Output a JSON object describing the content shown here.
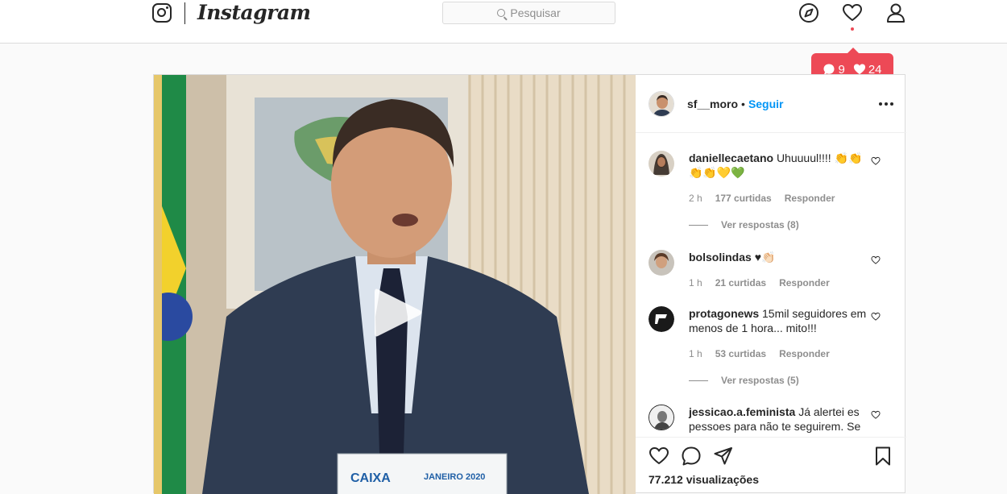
{
  "header": {
    "logo_text": "Instagram",
    "search_placeholder": "Pesquisar"
  },
  "activity": {
    "comments_count": "9",
    "likes_count": "24"
  },
  "post": {
    "username": "sf__moro",
    "separator": "•",
    "follow_label": "Seguir",
    "views_text": "77.212 visualizações",
    "calendar_brand": "CAIXA",
    "calendar_month": "JANEIRO 2020"
  },
  "comments": [
    {
      "user": "daniellecaetano",
      "text": "Uhuuuul!!!! 👏👏👏👏💛💚",
      "time": "2 h",
      "likes": "177 curtidas",
      "reply": "Responder",
      "replies": "Ver respostas (8)"
    },
    {
      "user": "bolsolindas",
      "text": "♥👏🏻",
      "time": "1 h",
      "likes": "21 curtidas",
      "reply": "Responder"
    },
    {
      "user": "protagonews",
      "text": "15mil seguidores em menos de 1 hora... mito!!!",
      "time": "1 h",
      "likes": "53 curtidas",
      "reply": "Responder",
      "replies": "Ver respostas (5)"
    },
    {
      "user": "jessicao.a.feminista",
      "text": "Já alertei es pessoes para não te seguirem. Se"
    }
  ],
  "colors": {
    "accent_blue": "#0095f6",
    "notification_red": "#ed4956",
    "border": "#dbdbdb"
  }
}
